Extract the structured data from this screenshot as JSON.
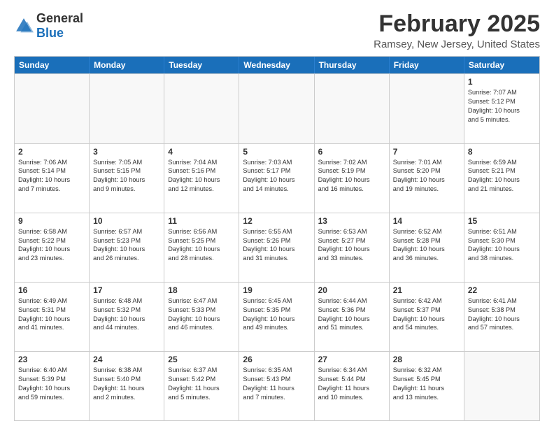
{
  "header": {
    "logo_general": "General",
    "logo_blue": "Blue",
    "month": "February 2025",
    "location": "Ramsey, New Jersey, United States"
  },
  "days_of_week": [
    "Sunday",
    "Monday",
    "Tuesday",
    "Wednesday",
    "Thursday",
    "Friday",
    "Saturday"
  ],
  "rows": [
    [
      {
        "day": "",
        "empty": true
      },
      {
        "day": "",
        "empty": true
      },
      {
        "day": "",
        "empty": true
      },
      {
        "day": "",
        "empty": true
      },
      {
        "day": "",
        "empty": true
      },
      {
        "day": "",
        "empty": true
      },
      {
        "day": "1",
        "text": "Sunrise: 7:07 AM\nSunset: 5:12 PM\nDaylight: 10 hours\nand 5 minutes."
      }
    ],
    [
      {
        "day": "2",
        "text": "Sunrise: 7:06 AM\nSunset: 5:14 PM\nDaylight: 10 hours\nand 7 minutes."
      },
      {
        "day": "3",
        "text": "Sunrise: 7:05 AM\nSunset: 5:15 PM\nDaylight: 10 hours\nand 9 minutes."
      },
      {
        "day": "4",
        "text": "Sunrise: 7:04 AM\nSunset: 5:16 PM\nDaylight: 10 hours\nand 12 minutes."
      },
      {
        "day": "5",
        "text": "Sunrise: 7:03 AM\nSunset: 5:17 PM\nDaylight: 10 hours\nand 14 minutes."
      },
      {
        "day": "6",
        "text": "Sunrise: 7:02 AM\nSunset: 5:19 PM\nDaylight: 10 hours\nand 16 minutes."
      },
      {
        "day": "7",
        "text": "Sunrise: 7:01 AM\nSunset: 5:20 PM\nDaylight: 10 hours\nand 19 minutes."
      },
      {
        "day": "8",
        "text": "Sunrise: 6:59 AM\nSunset: 5:21 PM\nDaylight: 10 hours\nand 21 minutes."
      }
    ],
    [
      {
        "day": "9",
        "text": "Sunrise: 6:58 AM\nSunset: 5:22 PM\nDaylight: 10 hours\nand 23 minutes."
      },
      {
        "day": "10",
        "text": "Sunrise: 6:57 AM\nSunset: 5:23 PM\nDaylight: 10 hours\nand 26 minutes."
      },
      {
        "day": "11",
        "text": "Sunrise: 6:56 AM\nSunset: 5:25 PM\nDaylight: 10 hours\nand 28 minutes."
      },
      {
        "day": "12",
        "text": "Sunrise: 6:55 AM\nSunset: 5:26 PM\nDaylight: 10 hours\nand 31 minutes."
      },
      {
        "day": "13",
        "text": "Sunrise: 6:53 AM\nSunset: 5:27 PM\nDaylight: 10 hours\nand 33 minutes."
      },
      {
        "day": "14",
        "text": "Sunrise: 6:52 AM\nSunset: 5:28 PM\nDaylight: 10 hours\nand 36 minutes."
      },
      {
        "day": "15",
        "text": "Sunrise: 6:51 AM\nSunset: 5:30 PM\nDaylight: 10 hours\nand 38 minutes."
      }
    ],
    [
      {
        "day": "16",
        "text": "Sunrise: 6:49 AM\nSunset: 5:31 PM\nDaylight: 10 hours\nand 41 minutes."
      },
      {
        "day": "17",
        "text": "Sunrise: 6:48 AM\nSunset: 5:32 PM\nDaylight: 10 hours\nand 44 minutes."
      },
      {
        "day": "18",
        "text": "Sunrise: 6:47 AM\nSunset: 5:33 PM\nDaylight: 10 hours\nand 46 minutes."
      },
      {
        "day": "19",
        "text": "Sunrise: 6:45 AM\nSunset: 5:35 PM\nDaylight: 10 hours\nand 49 minutes."
      },
      {
        "day": "20",
        "text": "Sunrise: 6:44 AM\nSunset: 5:36 PM\nDaylight: 10 hours\nand 51 minutes."
      },
      {
        "day": "21",
        "text": "Sunrise: 6:42 AM\nSunset: 5:37 PM\nDaylight: 10 hours\nand 54 minutes."
      },
      {
        "day": "22",
        "text": "Sunrise: 6:41 AM\nSunset: 5:38 PM\nDaylight: 10 hours\nand 57 minutes."
      }
    ],
    [
      {
        "day": "23",
        "text": "Sunrise: 6:40 AM\nSunset: 5:39 PM\nDaylight: 10 hours\nand 59 minutes."
      },
      {
        "day": "24",
        "text": "Sunrise: 6:38 AM\nSunset: 5:40 PM\nDaylight: 11 hours\nand 2 minutes."
      },
      {
        "day": "25",
        "text": "Sunrise: 6:37 AM\nSunset: 5:42 PM\nDaylight: 11 hours\nand 5 minutes."
      },
      {
        "day": "26",
        "text": "Sunrise: 6:35 AM\nSunset: 5:43 PM\nDaylight: 11 hours\nand 7 minutes."
      },
      {
        "day": "27",
        "text": "Sunrise: 6:34 AM\nSunset: 5:44 PM\nDaylight: 11 hours\nand 10 minutes."
      },
      {
        "day": "28",
        "text": "Sunrise: 6:32 AM\nSunset: 5:45 PM\nDaylight: 11 hours\nand 13 minutes."
      },
      {
        "day": "",
        "empty": true
      }
    ]
  ]
}
